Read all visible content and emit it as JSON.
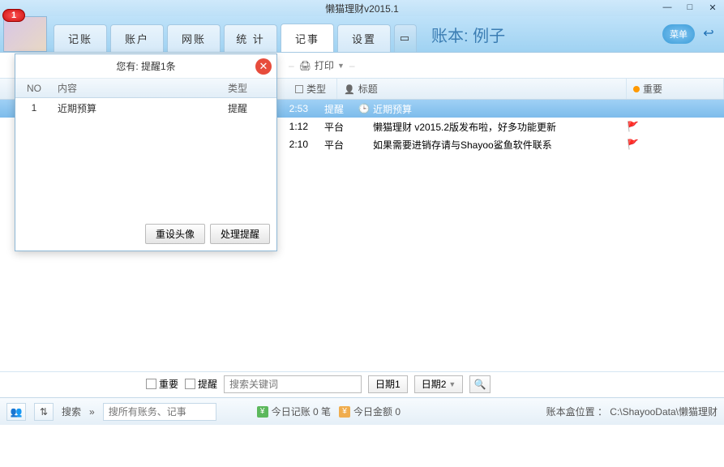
{
  "titlebar": {
    "title": "懒猫理财v2015.1"
  },
  "badge": "1",
  "tabs": [
    "记账",
    "账户",
    "网账",
    "统 计",
    "记事",
    "设置"
  ],
  "active_tab_index": 4,
  "ledger": {
    "prefix": "账本:",
    "name": "例子"
  },
  "menu_label": "菜单",
  "toolbar": {
    "print": "打印"
  },
  "columns": {
    "type": "类型",
    "title": "标题",
    "important": "重要"
  },
  "rows": [
    {
      "time": "2:53",
      "type": "提醒",
      "icon": "clock",
      "title": "近期预算",
      "flag": false,
      "selected": true
    },
    {
      "time": "1:12",
      "type": "平台",
      "icon": "",
      "title": "懒猫理财 v2015.2版发布啦，好多功能更新",
      "flag": true,
      "selected": false
    },
    {
      "time": "2:10",
      "type": "平台",
      "icon": "",
      "title": "如果需要进销存请与Shayoo鲨鱼软件联系",
      "flag": true,
      "selected": false
    }
  ],
  "popup": {
    "header": "您有: 提醒1条",
    "cols": {
      "no": "NO",
      "content": "内容",
      "type": "类型"
    },
    "rows": [
      {
        "no": "1",
        "content": "近期预算",
        "type": "提醒"
      }
    ],
    "btn_reset": "重设头像",
    "btn_handle": "处理提醒"
  },
  "filter": {
    "chk_important": "重要",
    "chk_remind": "提醒",
    "search_placeholder": "搜索关键词",
    "date1": "日期1",
    "date2": "日期2"
  },
  "status": {
    "search_label": "搜索",
    "search_placeholder": "搜所有账务、记事",
    "today_entries": "今日记账 0 笔",
    "today_amount": "今日金额 0",
    "box_location": "账本盒位置 ： C:\\ShayooData\\懒猫理财"
  }
}
